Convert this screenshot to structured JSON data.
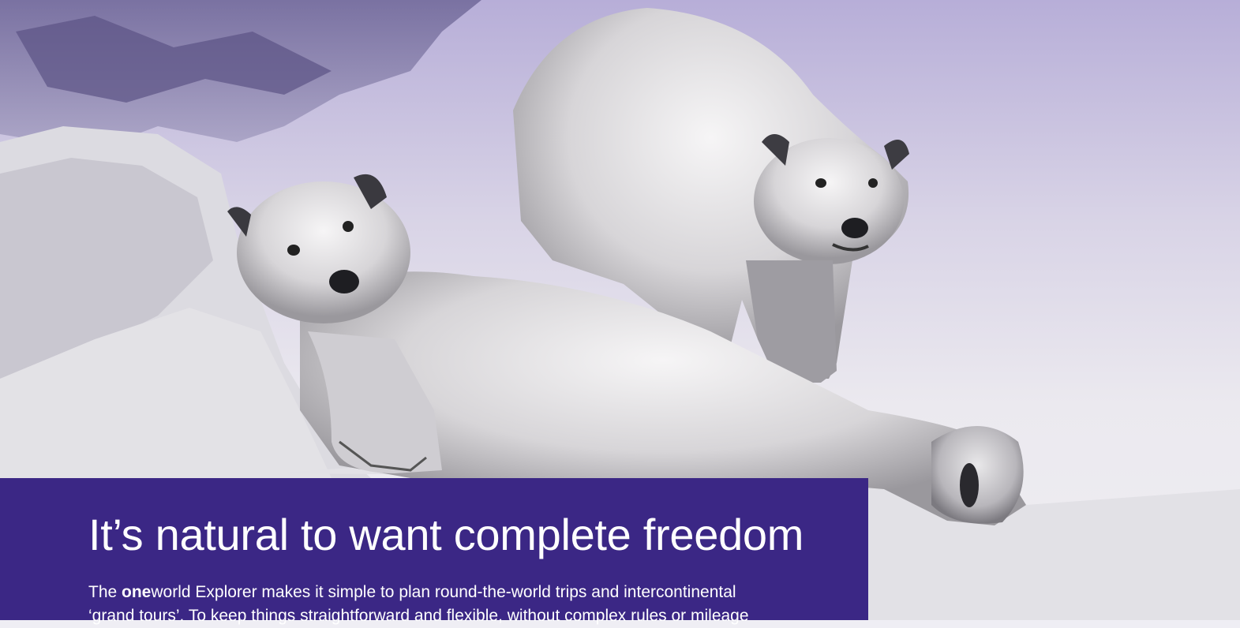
{
  "hero_image": {
    "description_icon": "polar-bears-photo",
    "tint_color": "#b7aed8",
    "snow_color": "#ecebef"
  },
  "promo": {
    "headline": "It’s natural to want complete freedom",
    "body": {
      "intro": "The ",
      "brand_bold": "one",
      "brand_regular": "world",
      "line1_rest": " Explorer makes it simple to plan round-the-world trips and intercontinental",
      "line2": "‘grand tours’. To keep things straightforward and flexible, without complex rules or mileage"
    },
    "panel_color": "#3b2785",
    "text_color": "#ffffff"
  }
}
